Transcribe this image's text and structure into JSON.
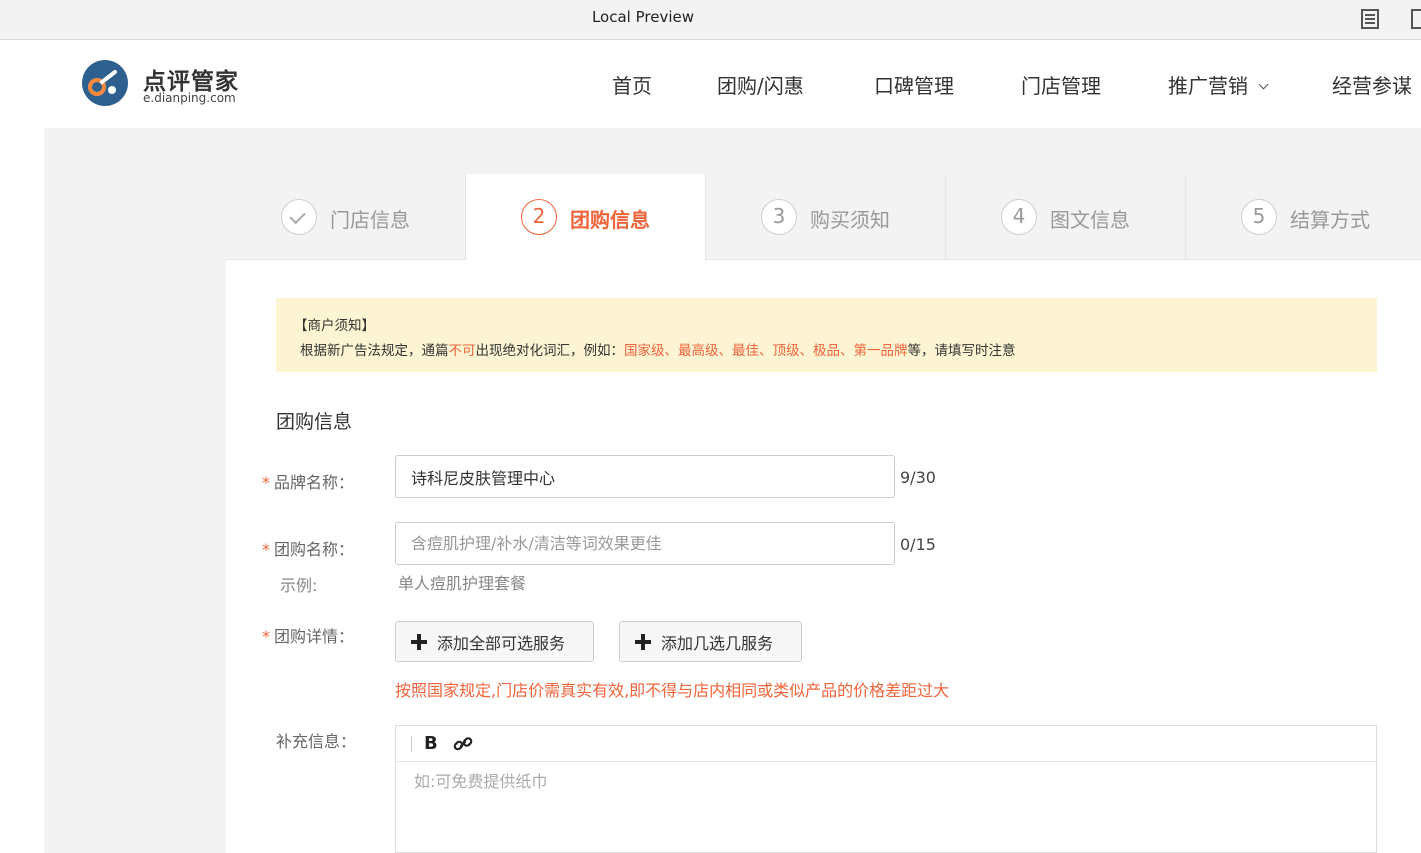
{
  "preview": {
    "title": "Local Preview",
    "reader_icon": "reader-view-icon",
    "extra_icon": "window-icon"
  },
  "header": {
    "logo": {
      "title": "点评管家",
      "subtitle": "e.dianping.com",
      "icon": "dianping-logo-icon"
    },
    "nav": [
      {
        "label": "首页"
      },
      {
        "label": "团购/闪惠"
      },
      {
        "label": "口碑管理"
      },
      {
        "label": "门店管理"
      },
      {
        "label": "推广营销"
      },
      {
        "label": "经营参谋"
      }
    ]
  },
  "steps": [
    {
      "num": "",
      "label": "门店信息",
      "state": "done"
    },
    {
      "num": "2",
      "label": "团购信息",
      "state": "active"
    },
    {
      "num": "3",
      "label": "购买须知",
      "state": "todo"
    },
    {
      "num": "4",
      "label": "图文信息",
      "state": "todo"
    },
    {
      "num": "5",
      "label": "结算方式",
      "state": "todo"
    }
  ],
  "notice": {
    "title": "【商户须知】",
    "text_1": "根据新广告法规定，通篇",
    "text_red_1": "不可",
    "text_2": "出现绝对化词汇，例如：",
    "text_red_2": "国家级、最高级、最佳、顶级、极品、第一品牌",
    "text_3": "等，请填写时注意"
  },
  "form": {
    "section_title": "团购信息",
    "required_mark": "*",
    "brand": {
      "label": "品牌名称：",
      "value": "诗科尼皮肤管理中心",
      "counter": "9/30"
    },
    "deal_name": {
      "label": "团购名称：",
      "value": "",
      "placeholder": "含痘肌护理/补水/清洁等词效果更佳",
      "counter": "0/15"
    },
    "example": {
      "label": "示例:",
      "value": "单人痘肌护理套餐"
    },
    "details": {
      "label": "团购详情：",
      "add_all_label": "添加全部可选服务",
      "add_some_label": "添加几选几服务",
      "warning": "按照国家规定,门店价需真实有效,即不得与店内相同或类似产品的价格差距过大"
    },
    "extra": {
      "label": "补充信息：",
      "bold_label": "B",
      "placeholder": "如:可免费提供纸巾"
    }
  },
  "colors": {
    "accent": "#f0643c",
    "notice_bg": "#fcf4d2",
    "page_bg": "#f3f3f3"
  }
}
